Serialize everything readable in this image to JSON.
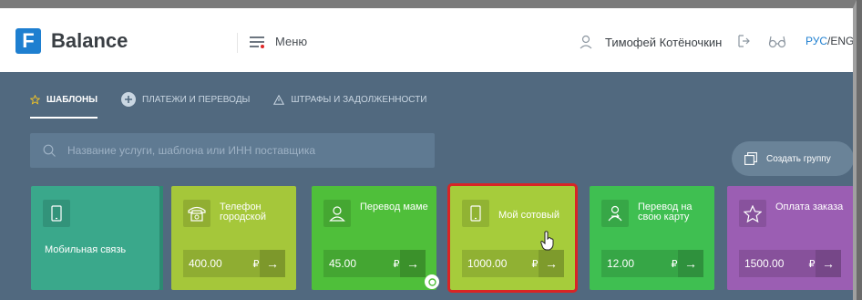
{
  "header": {
    "logo_letter": "F",
    "brand": "Balance",
    "menu_label": "Меню",
    "user_name": "Тимофей Котёночкин",
    "lang_active": "РУС",
    "lang_separator": "/",
    "lang_other": "ENG"
  },
  "tabs": [
    {
      "label": "ШАБЛОНЫ",
      "icon": "star-icon",
      "active": true
    },
    {
      "label": "ПЛАТЕЖИ И ПЕРЕВОДЫ",
      "icon": "plus-circle-icon",
      "active": false
    },
    {
      "label": "ШТРАФЫ И ЗАДОЛЖЕННОСТИ",
      "icon": "warning-icon",
      "active": false
    }
  ],
  "search": {
    "placeholder": "Название услуги, шаблона или ИНН поставщика"
  },
  "group_button": {
    "label": "Создать группу"
  },
  "cards": [
    {
      "title": "Мобильная связь",
      "icon": "phone-icon",
      "color": "#3aa88b"
    },
    {
      "title": "Телефон городской",
      "icon": "landline-phone-icon",
      "amount": "400.00",
      "currency": "₽",
      "color": "#a5c73a"
    },
    {
      "title": "Перевод маме",
      "icon": "person-icon",
      "amount": "45.00",
      "currency": "₽",
      "color": "#4fbf3a"
    },
    {
      "title": "Мой сотовый",
      "icon": "phone-icon",
      "amount": "1000.00",
      "currency": "₽",
      "color": "#a6cc3b",
      "highlighted": true
    },
    {
      "title": "Перевод на свою карту",
      "icon": "person-transfer-icon",
      "amount": "12.00",
      "currency": "₽",
      "color": "#3fbf51"
    },
    {
      "title": "Оплата заказа",
      "icon": "star-icon",
      "amount": "1500.00",
      "currency": "₽",
      "color": "#9b5eb3"
    }
  ],
  "colors": {
    "brand_blue": "#1e7fd0",
    "background": "#51697f",
    "highlight_border": "#d82525"
  }
}
